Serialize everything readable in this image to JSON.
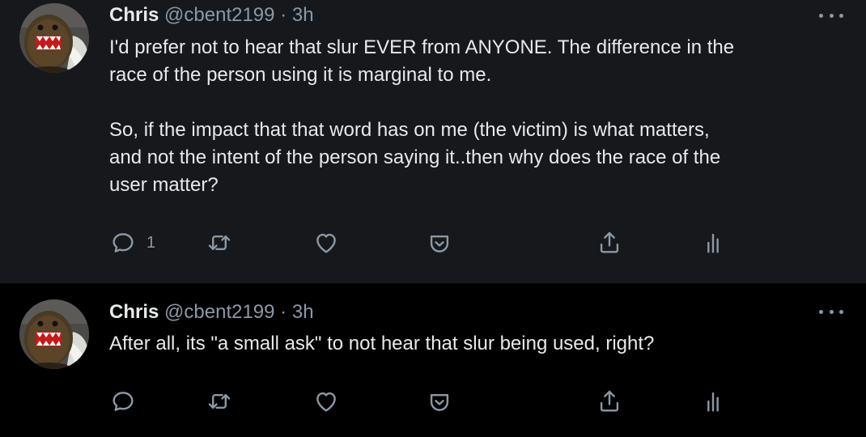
{
  "tweets": [
    {
      "name": "Chris",
      "handle": "@cbent2199",
      "separator": "·",
      "time": "3h",
      "paragraphs": [
        "I'd prefer not to hear that slur EVER from ANYONE. The difference in the\nrace of the person using it is marginal to me.",
        "So, if the impact that that word has on me (the victim) is what matters,\nand not the intent of the person saying it..then why does the race of the\nuser matter?"
      ],
      "reply_count": "1"
    },
    {
      "name": "Chris",
      "handle": "@cbent2199",
      "separator": "·",
      "time": "3h",
      "paragraphs": [
        "After all, its \"a small ask\" to not hear that slur being used, right?"
      ],
      "reply_count": ""
    }
  ],
  "icons": {
    "reply": "reply-icon",
    "retweet": "retweet-icon",
    "like": "heart-icon",
    "downvote": "downvote-icon",
    "share": "share-icon",
    "analytics": "analytics-icon",
    "more": "more-icon"
  },
  "colors": {
    "background_highlight": "#16181c",
    "background": "#000000",
    "text": "#e7e9ea",
    "secondary_text": "#8b98a5",
    "thread_line": "#3e4144"
  }
}
